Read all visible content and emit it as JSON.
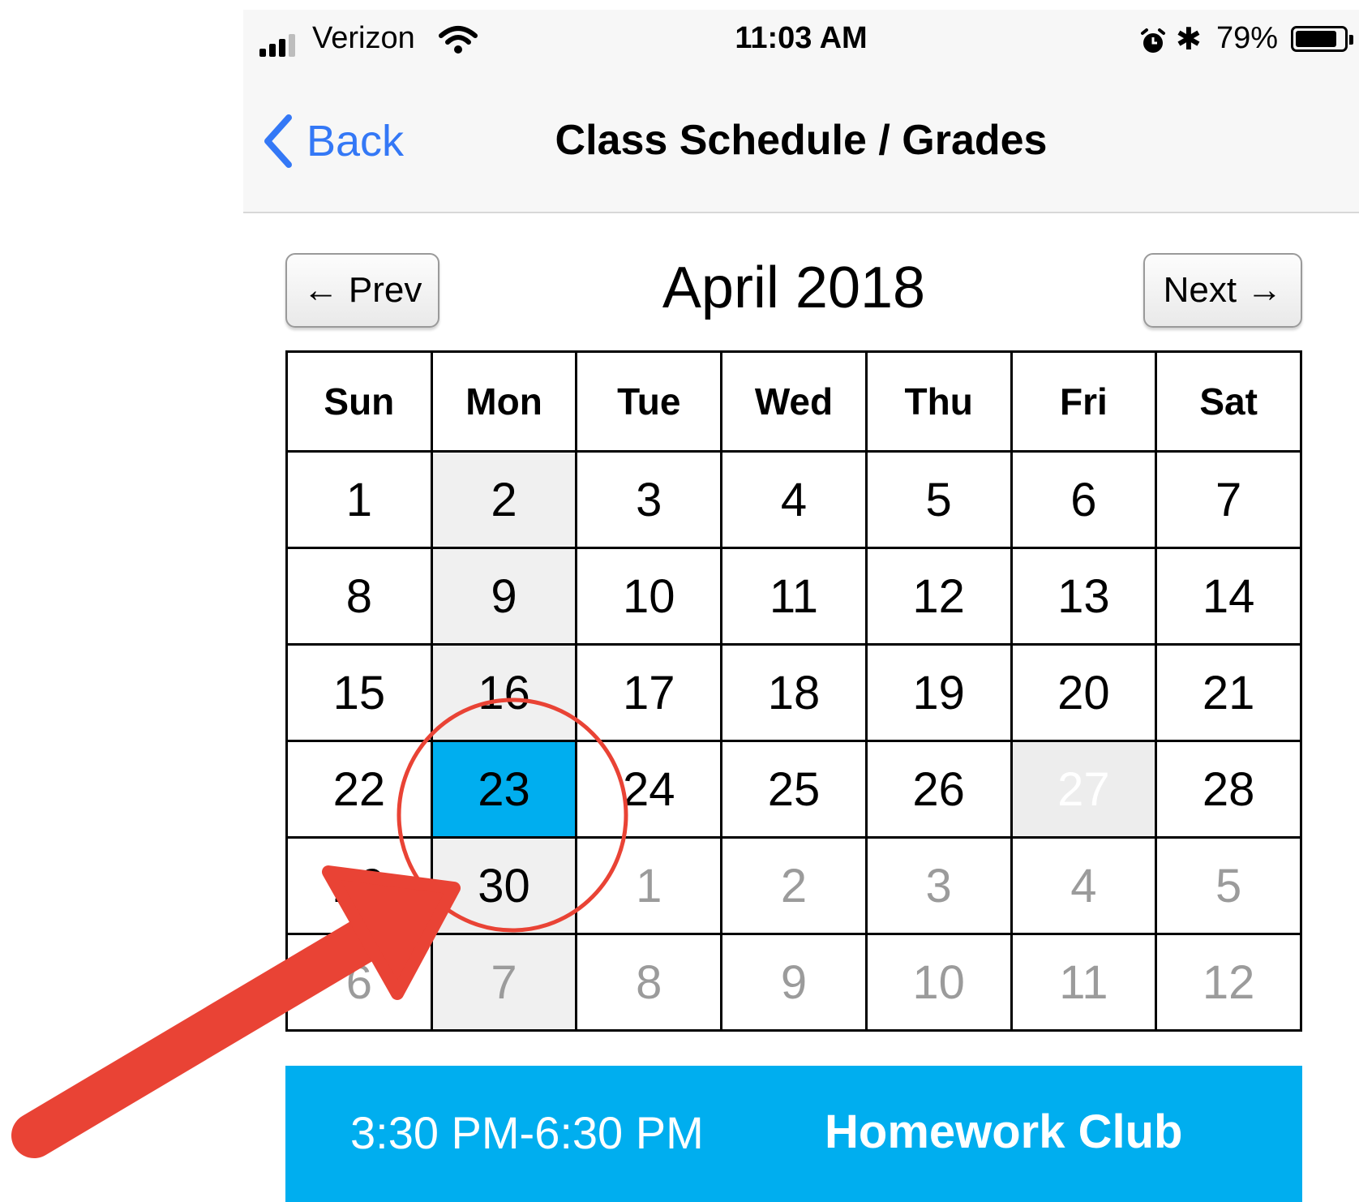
{
  "status_bar": {
    "carrier": "Verizon",
    "time": "11:03 AM",
    "bluetooth": "✱",
    "battery": "79%",
    "icons": [
      "signal-icon",
      "wifi-icon",
      "alarm-icon",
      "bluetooth-icon",
      "battery-icon"
    ]
  },
  "nav": {
    "back_label": "Back",
    "title": "Class Schedule / Grades"
  },
  "calendar": {
    "prev_label": "← Prev",
    "next_label": "Next →",
    "month": "April 2018",
    "weekdays": [
      "Sun",
      "Mon",
      "Tue",
      "Wed",
      "Thu",
      "Fri",
      "Sat"
    ],
    "weeks": [
      [
        "1",
        "2",
        "3",
        "4",
        "5",
        "6",
        "7"
      ],
      [
        "8",
        "9",
        "10",
        "11",
        "12",
        "13",
        "14"
      ],
      [
        "15",
        "16",
        "17",
        "18",
        "19",
        "20",
        "21"
      ],
      [
        "22",
        "23",
        "24",
        "25",
        "26",
        "27",
        "28"
      ],
      [
        "29",
        "30",
        "1",
        "2",
        "3",
        "4",
        "5"
      ],
      [
        "6",
        "7",
        "8",
        "9",
        "10",
        "11",
        "12"
      ]
    ],
    "selected_day": "23"
  },
  "event": {
    "time": "3:30 PM-6:30 PM",
    "name": "Homework Club"
  },
  "colors": {
    "accent": "#00aeef",
    "ios_blue": "#3478f6",
    "annotation": "#e94335"
  },
  "annotation": [
    "circle",
    "arrow"
  ]
}
